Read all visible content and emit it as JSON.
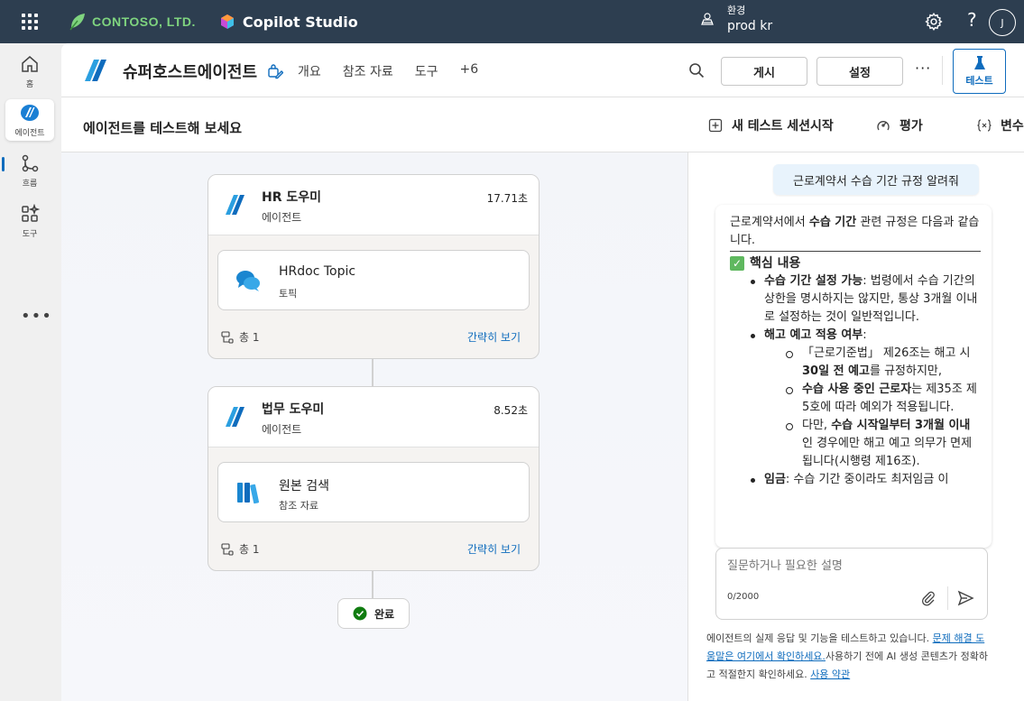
{
  "topbar": {
    "org_name": "CONTOSO, LTD.",
    "product_name": "Copilot Studio",
    "env_label": "환경",
    "env_value": "prod kr",
    "help": "?",
    "avatar_initial": "J"
  },
  "rail": {
    "items": [
      {
        "label": "홈",
        "icon": "home-icon"
      },
      {
        "label": "에이전트",
        "icon": "agents-icon"
      },
      {
        "label": "흐름",
        "icon": "flows-icon"
      },
      {
        "label": "도구",
        "icon": "tools-icon"
      }
    ],
    "more": "•••"
  },
  "header": {
    "agent_name": "슈퍼호스트에이전트",
    "tabs": [
      "개요",
      "참조 자료",
      "도구",
      "+6"
    ],
    "publish_label": "게시",
    "settings_label": "설정",
    "more": "···",
    "test_label": "테스트"
  },
  "subheader": {
    "title": "에이전트를 테스트해 보세요",
    "new_session_label": "새 테스트 세션시작",
    "evaluate_label": "평가",
    "variables_label": "변수"
  },
  "canvas": {
    "cards": [
      {
        "title": "HR 도우미",
        "subtitle": "에이전트",
        "time": "17.71초",
        "inner_title": "HRdoc Topic",
        "inner_subtitle": "토픽",
        "inner_icon": "chat-bubbles-icon",
        "total": "총 1",
        "link": "간략히 보기"
      },
      {
        "title": "법무 도우미",
        "subtitle": "에이전트",
        "time": "8.52초",
        "inner_title": "원본 검색",
        "inner_subtitle": "참조 자료",
        "inner_icon": "books-icon",
        "total": "총 1",
        "link": "간략히 보기"
      }
    ],
    "done_label": "완료"
  },
  "chat": {
    "user_message": "근로계약서 수습 기간 규정 알려줘",
    "bot": {
      "intro_a": "근로계약서에서 ",
      "intro_b": "수습 기간",
      "intro_c": " 관련 규정은 다음과 같습니다.",
      "heading": "핵심 내용",
      "b1_bold": "수습 기간 설정 가능",
      "b1_text": ": 법령에서 수습 기간의 상한을 명시하지는 않지만, 통상 3개월 이내로 설정하는 것이 일반적입니다.",
      "b2_bold": "해고 예고 적용 여부",
      "b2_text": ":",
      "s1_a": "「근로기준법」 제26조는 해고 시 ",
      "s1_b": "30일 전 예고",
      "s1_c": "를 규정하지만,",
      "s2_b": "수습 사용 중인 근로자",
      "s2_c": "는 제35조 제5호에 따라 예외가 적용됩니다.",
      "s3_a": "다만, ",
      "s3_b": "수습 시작일부터 3개월 이내",
      "s3_c": "인 경우에만 해고 예고 의무가 면제됩니다(시행령 제16조).",
      "b3_bold": "임금",
      "b3_text": ": 수습 기간 중이라도 최저임금 이"
    },
    "composer_placeholder": "질문하거나 필요한 설명",
    "composer_count": "0/2000",
    "disclaimer_a": "에이전트의 실제 응답 및 기능을 테스트하고 있습니다. ",
    "disclaimer_link1": "문제 해결 도움말은 여기에서 확인하세요.",
    "disclaimer_b": "사용하기 전에 AI 생성 콘텐츠가 정확하고 적절한지 확인하세요. ",
    "disclaimer_link2": "사용 약관"
  },
  "colors": {
    "topbar": "#2d3e50",
    "accent": "#0f6cbd",
    "brand_green": "#7fd47f",
    "user_bubble": "#e8f3fc",
    "success": "#107c10"
  }
}
